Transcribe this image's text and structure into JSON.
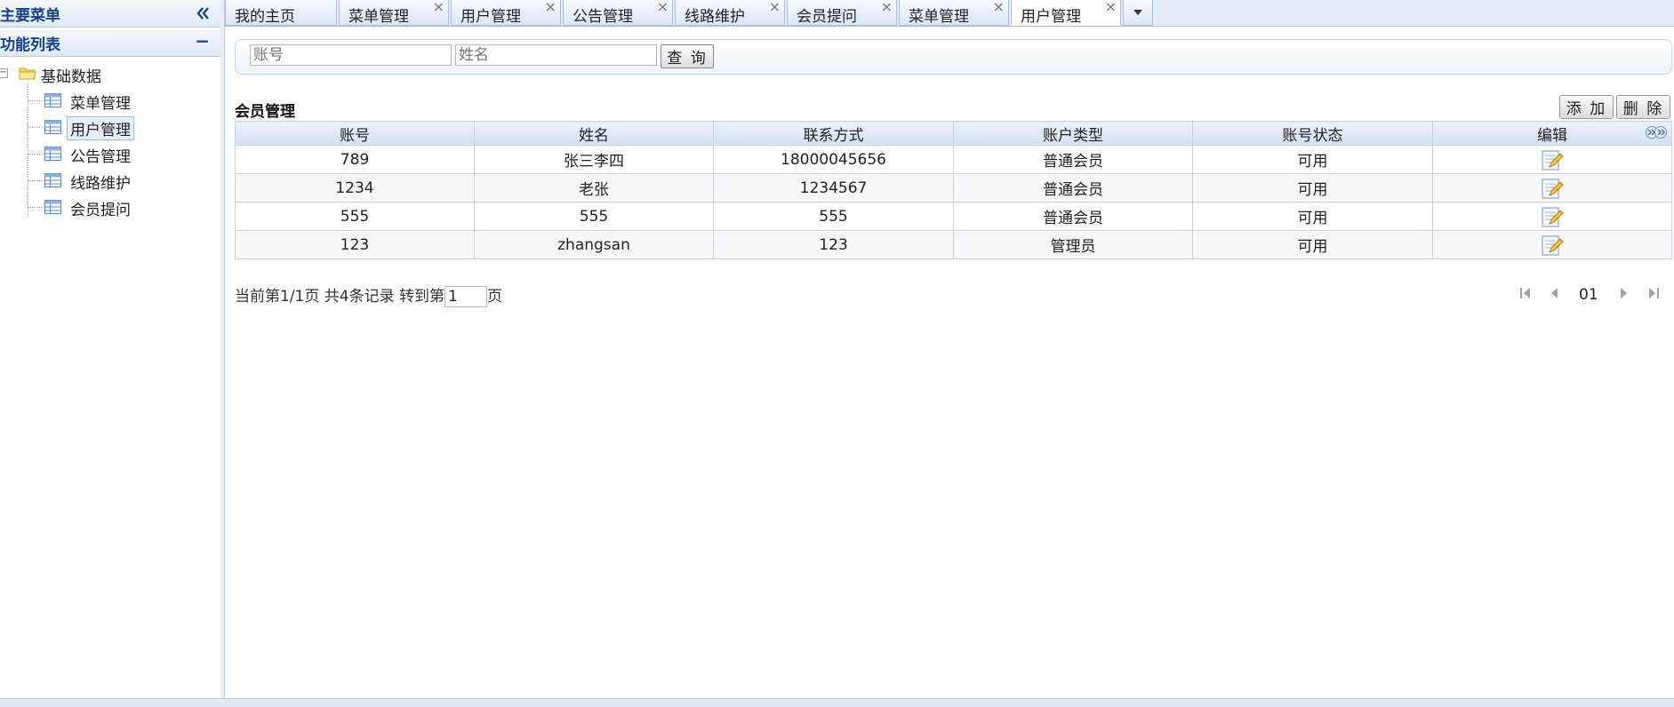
{
  "sidebar": {
    "main_menu_title": "主要菜单",
    "collapse_icon": "double-chevron-left-icon",
    "function_list_title": "功能列表",
    "function_list_toggle": "−",
    "tree": {
      "root_label": "基础数据",
      "root_toggle": "−",
      "items": [
        {
          "label": "菜单管理"
        },
        {
          "label": "用户管理",
          "selected": true
        },
        {
          "label": "公告管理"
        },
        {
          "label": "线路维护"
        },
        {
          "label": "会员提问"
        }
      ]
    }
  },
  "tabs": [
    {
      "label": "我的主页",
      "closable": false
    },
    {
      "label": "菜单管理",
      "closable": true
    },
    {
      "label": "用户管理",
      "closable": true
    },
    {
      "label": "公告管理",
      "closable": true
    },
    {
      "label": "线路维护",
      "closable": true
    },
    {
      "label": "会员提问",
      "closable": true
    },
    {
      "label": "菜单管理",
      "closable": true
    },
    {
      "label": "用户管理",
      "closable": true,
      "active": true
    }
  ],
  "tab_close_glyph": "×",
  "search": {
    "account_placeholder": "账号",
    "name_placeholder": "姓名",
    "query_label": "查 询"
  },
  "grid": {
    "title": "会员管理",
    "add_label": "添 加",
    "delete_label": "删 除",
    "columns": [
      "账号",
      "姓名",
      "联系方式",
      "账户类型",
      "账号状态",
      "编辑"
    ],
    "rows": [
      [
        "789",
        "张三李四",
        "18000045656",
        "普通会员",
        "可用"
      ],
      [
        "1234",
        "老张",
        "1234567",
        "普通会员",
        "可用"
      ],
      [
        "555",
        "555",
        "555",
        "普通会员",
        "可用"
      ],
      [
        "123",
        "zhangsan",
        "123",
        "管理员",
        "可用"
      ]
    ]
  },
  "pager": {
    "info_prefix": "当前第1/1页 共4条记录 转到第",
    "page_value": "1",
    "info_suffix": "页",
    "current_page": "01"
  },
  "colors": {
    "header_text": "#15428b",
    "border": "#b7cbe0",
    "tab_bg": "#d9e6f4"
  }
}
